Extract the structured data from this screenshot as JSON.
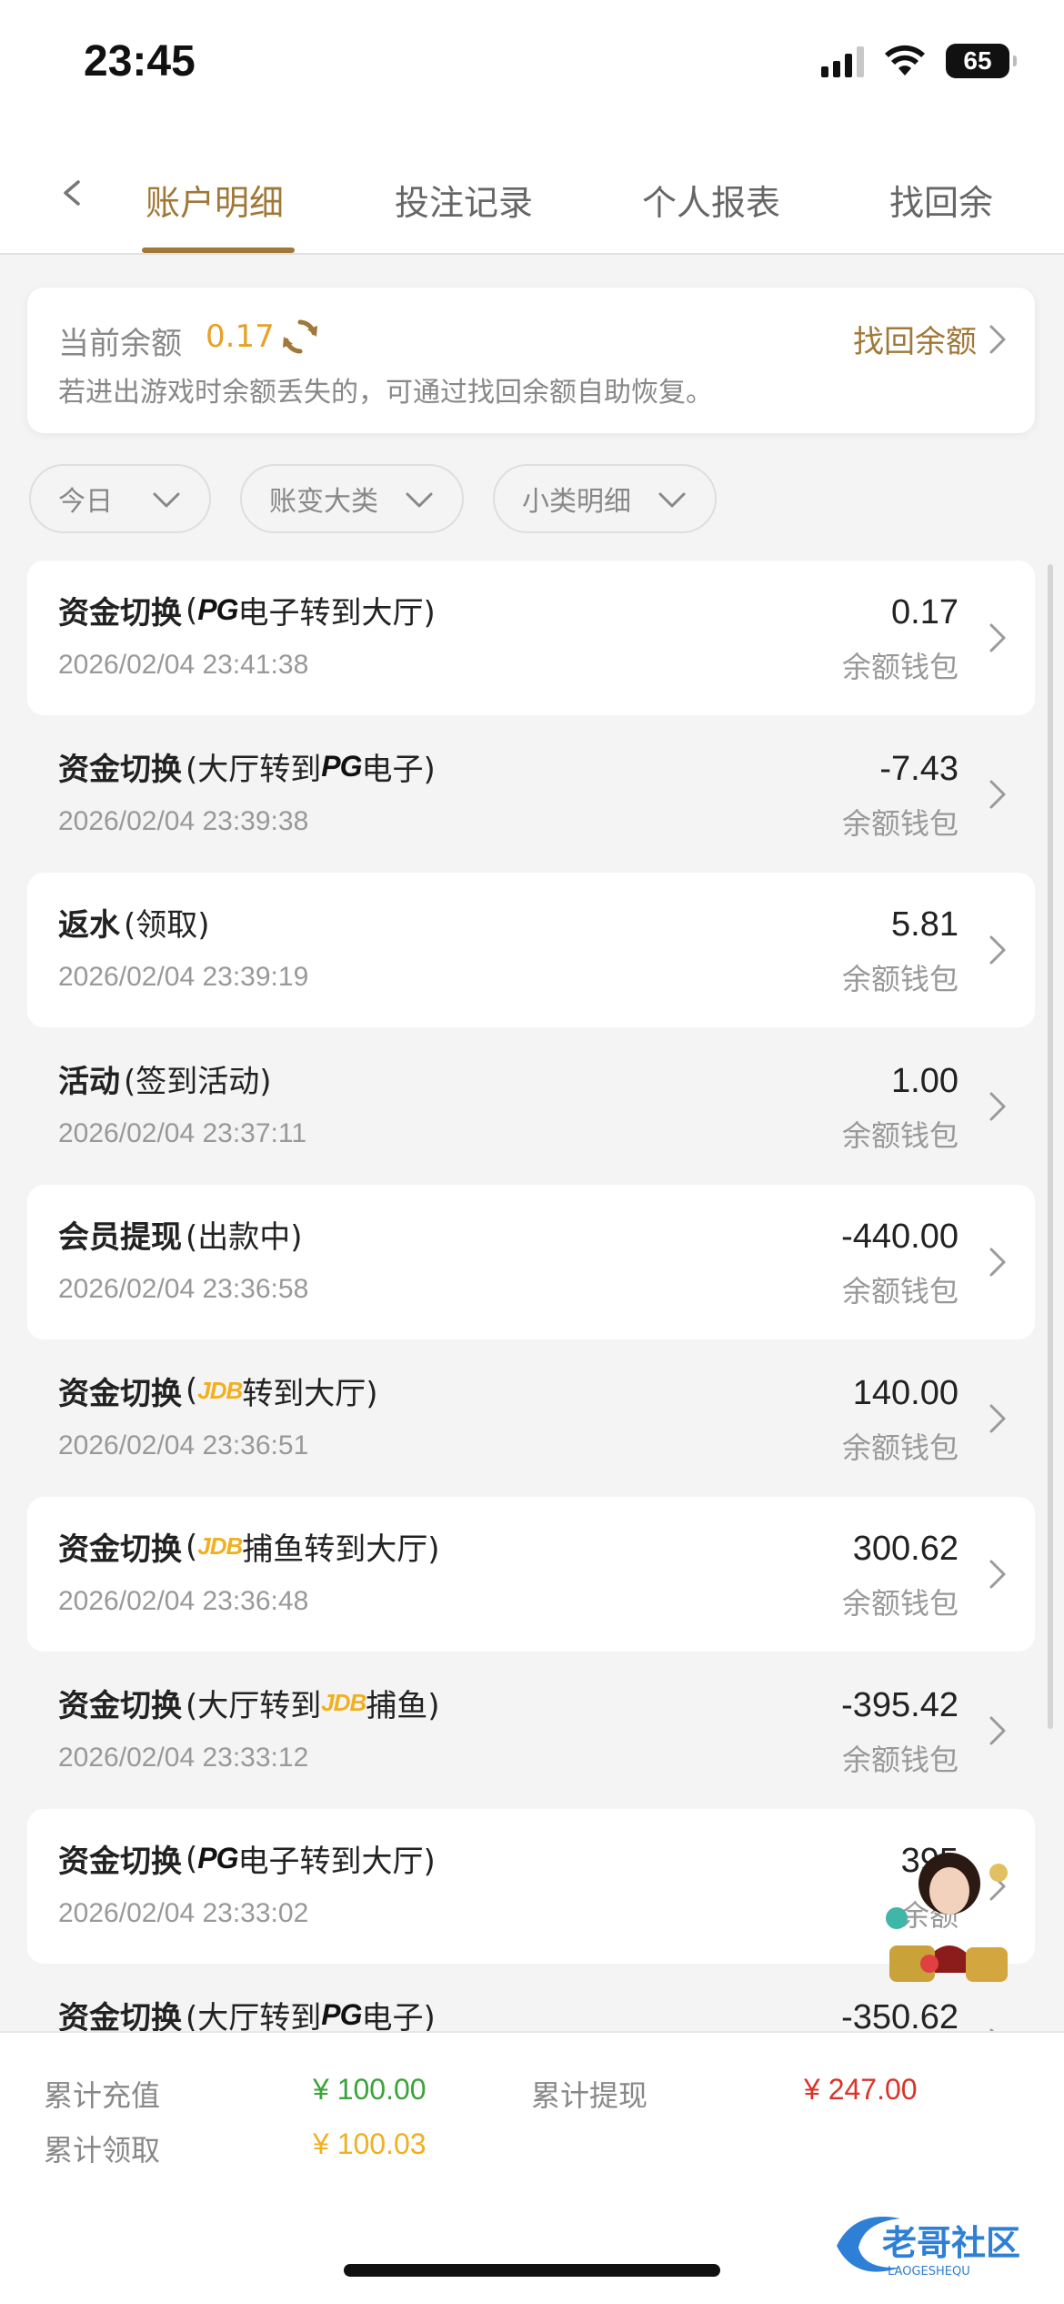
{
  "status": {
    "time": "23:45",
    "battery": "65"
  },
  "tabs": [
    {
      "label": "账户明细",
      "active": true
    },
    {
      "label": "投注记录"
    },
    {
      "label": "个人报表"
    },
    {
      "label": "找回余"
    }
  ],
  "balance": {
    "label": "当前余额",
    "value": "0.17",
    "hint": "若进出游戏时余额丢失的，可通过找回余额自助恢复。",
    "recover_label": "找回余额"
  },
  "filters": [
    "今日",
    "账变大类",
    "小类明细"
  ],
  "records": [
    {
      "category": "资金切换",
      "open": " (",
      "brand": "PG",
      "brand_style": "pg",
      "detail": "电子转到大厅)",
      "time": "2026/02/04 23:41:38",
      "amount": "0.17",
      "wallet": "余额钱包"
    },
    {
      "category": "资金切换",
      "open": " (大厅转到",
      "brand": "PG",
      "brand_style": "pg",
      "detail": "电子)",
      "time": "2026/02/04 23:39:38",
      "amount": "-7.43",
      "wallet": "余额钱包"
    },
    {
      "category": "返水",
      "open": " (领取)",
      "brand": "",
      "brand_style": "",
      "detail": "",
      "time": "2026/02/04 23:39:19",
      "amount": "5.81",
      "wallet": "余额钱包"
    },
    {
      "category": "活动",
      "open": " (签到活动)",
      "brand": "",
      "brand_style": "",
      "detail": "",
      "time": "2026/02/04 23:37:11",
      "amount": "1.00",
      "wallet": "余额钱包"
    },
    {
      "category": "会员提现",
      "open": " (出款中)",
      "brand": "",
      "brand_style": "",
      "detail": "",
      "time": "2026/02/04 23:36:58",
      "amount": "-440.00",
      "wallet": "余额钱包"
    },
    {
      "category": "资金切换",
      "open": " (",
      "brand": "JDB",
      "brand_style": "jdb",
      "detail": "转到大厅)",
      "time": "2026/02/04 23:36:51",
      "amount": "140.00",
      "wallet": "余额钱包"
    },
    {
      "category": "资金切换",
      "open": " (",
      "brand": "JDB",
      "brand_style": "jdb",
      "detail": "捕鱼转到大厅)",
      "time": "2026/02/04 23:36:48",
      "amount": "300.62",
      "wallet": "余额钱包"
    },
    {
      "category": "资金切换",
      "open": " (大厅转到",
      "brand": "JDB",
      "brand_style": "jdb",
      "detail": "捕鱼)",
      "time": "2026/02/04 23:33:12",
      "amount": "-395.42",
      "wallet": "余额钱包"
    },
    {
      "category": "资金切换",
      "open": " (",
      "brand": "PG",
      "brand_style": "pg",
      "detail": "电子转到大厅)",
      "time": "2026/02/04 23:33:02",
      "amount": "395",
      "wallet": "余额"
    },
    {
      "category": "资金切换",
      "open": " (大厅转到",
      "brand": "PG",
      "brand_style": "pg",
      "detail": "电子)",
      "time": "",
      "amount": "-350.62",
      "wallet": ""
    }
  ],
  "summary": {
    "recharge_label": "累计充值",
    "recharge_value": "¥ 100.00",
    "withdraw_label": "累计提现",
    "withdraw_value": "¥ 247.00",
    "claim_label": "累计领取",
    "claim_value": "¥ 100.03"
  },
  "watermark": {
    "text": "老哥社区",
    "sub": "LAOGESHEQU"
  },
  "colors": {
    "accent": "#a07838",
    "balance": "#e6a126",
    "recharge": "#3aa33a",
    "withdraw": "#d9342b",
    "claim": "#f0b020"
  }
}
